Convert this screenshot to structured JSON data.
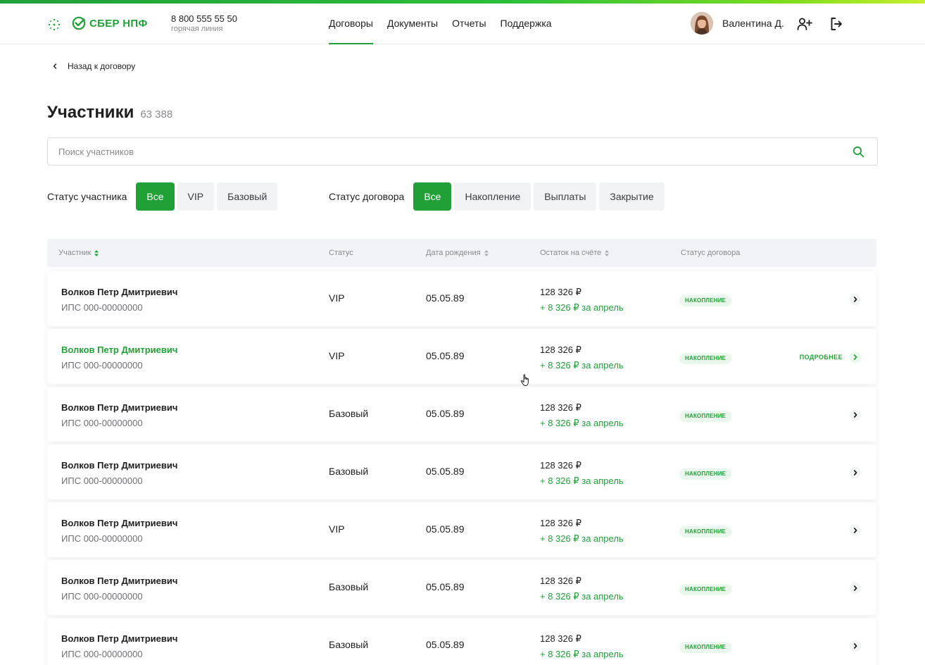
{
  "colors": {
    "accent": "#21a038",
    "text": "#1f1f22",
    "muted": "#8a8a90",
    "chip_bg": "#f2f3f5",
    "badge_bg": "#eaf7ec"
  },
  "header": {
    "logo": "СБЕР НПФ",
    "phone": "8 800 555 55 50",
    "phone_caption": "горячая линия",
    "nav": [
      {
        "label": "Договоры",
        "active": true
      },
      {
        "label": "Документы",
        "active": false
      },
      {
        "label": "Отчеты",
        "active": false
      },
      {
        "label": "Поддержка",
        "active": false
      }
    ],
    "user_name": "Валентина Д.",
    "icons": {
      "menu": "grid-dots-icon",
      "add_user": "user-plus-icon",
      "logout": "logout-icon"
    }
  },
  "back_link": "Назад к договору",
  "page": {
    "title": "Участники",
    "count": "63 388"
  },
  "search": {
    "placeholder": "Поиск участников",
    "value": ""
  },
  "filters": {
    "participant_status": {
      "label": "Статус участника",
      "options": [
        "Все",
        "VIP",
        "Базовый"
      ],
      "selected": "Все"
    },
    "contract_status": {
      "label": "Статус  договора",
      "options": [
        "Все",
        "Накопление",
        "Выплаты",
        "Закрытие"
      ],
      "selected": "Все"
    }
  },
  "table": {
    "columns": [
      {
        "label": "Участник",
        "sortable": true
      },
      {
        "label": "Статус",
        "sortable": false
      },
      {
        "label": "Дата рождения",
        "sortable": true
      },
      {
        "label": "Остаток на счёте",
        "sortable": true
      },
      {
        "label": "Статус договора",
        "sortable": false
      }
    ],
    "more_label": "ПОДРОБНЕЕ",
    "rows": [
      {
        "name": "Волков Петр Дмитриевич",
        "ips": "ИПС 000-00000000",
        "status": "VIP",
        "birth": "05.05.89",
        "balance": "128 326 ₽",
        "delta": "+ 8 326 ₽ за апрель",
        "contract": "НАКОПЛЕНИЕ",
        "hover": false
      },
      {
        "name": "Волков Петр Дмитриевич",
        "ips": "ИПС 000-00000000",
        "status": "VIP",
        "birth": "05.05.89",
        "balance": "128 326 ₽",
        "delta": "+ 8 326 ₽ за апрель",
        "contract": "НАКОПЛЕНИЕ",
        "hover": true
      },
      {
        "name": "Волков Петр Дмитриевич",
        "ips": "ИПС 000-00000000",
        "status": "Базовый",
        "birth": "05.05.89",
        "balance": "128 326 ₽",
        "delta": "+ 8 326 ₽ за апрель",
        "contract": "НАКОПЛЕНИЕ",
        "hover": false
      },
      {
        "name": "Волков Петр Дмитриевич",
        "ips": "ИПС 000-00000000",
        "status": "Базовый",
        "birth": "05.05.89",
        "balance": "128 326 ₽",
        "delta": "+ 8 326 ₽ за апрель",
        "contract": "НАКОПЛЕНИЕ",
        "hover": false
      },
      {
        "name": "Волков Петр Дмитриевич",
        "ips": "ИПС 000-00000000",
        "status": "VIP",
        "birth": "05.05.89",
        "balance": "128 326 ₽",
        "delta": "+ 8 326 ₽ за апрель",
        "contract": "НАКОПЛЕНИЕ",
        "hover": false
      },
      {
        "name": "Волков Петр Дмитриевич",
        "ips": "ИПС 000-00000000",
        "status": "Базовый",
        "birth": "05.05.89",
        "balance": "128 326 ₽",
        "delta": "+ 8 326 ₽ за апрель",
        "contract": "НАКОПЛЕНИЕ",
        "hover": false
      },
      {
        "name": "Волков Петр Дмитриевич",
        "ips": "ИПС 000-00000000",
        "status": "Базовый",
        "birth": "05.05.89",
        "balance": "128 326 ₽",
        "delta": "+ 8 326 ₽ за апрель",
        "contract": "НАКОПЛЕНИЕ",
        "hover": false
      }
    ]
  }
}
